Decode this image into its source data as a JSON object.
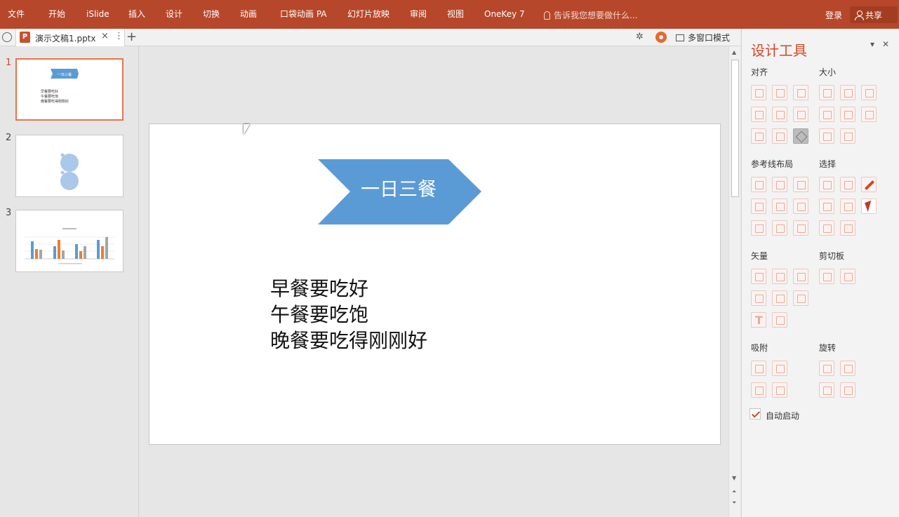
{
  "menu": {
    "items": [
      "文件",
      "开始",
      "iSlide",
      "插入",
      "设计",
      "切换",
      "动画",
      "口袋动画 PA",
      "幻灯片放映",
      "审阅",
      "视图",
      "OneKey 7"
    ],
    "tell_me": "告诉我您想要做什么...",
    "login": "登录",
    "share": "共享"
  },
  "tabbar": {
    "file_tab": "演示文稿1.pptx",
    "app_icon": "P",
    "close": "×",
    "more": "⋮",
    "add": "+",
    "multi_window": "多窗口模式"
  },
  "thumbnails": [
    {
      "num": "1",
      "selected": true,
      "chevron_text": "一日三餐",
      "lines": [
        "早餐要吃好",
        "午餐要吃饱",
        "晚餐要吃得刚刚好"
      ]
    },
    {
      "num": "2",
      "selected": false
    },
    {
      "num": "3",
      "selected": false
    }
  ],
  "slide": {
    "chevron_text": "一日三餐",
    "chevron_color": "#5b9bd5",
    "body_lines": [
      "早餐要吃好",
      "午餐要吃饱",
      "晚餐要吃得刚刚好"
    ]
  },
  "panel": {
    "title": "设计工具",
    "sections": {
      "align": "对齐",
      "size": "大小",
      "guides": "参考线布局",
      "select": "选择",
      "vector": "矢量",
      "clipboard": "剪切板",
      "snap": "吸附",
      "rotate": "旋转"
    },
    "auto_start": "自动启动",
    "auto_start_checked": true
  },
  "colors": {
    "ribbon": "#b7472a",
    "accent": "#d24726",
    "thumb_selected": "#e7744d"
  }
}
